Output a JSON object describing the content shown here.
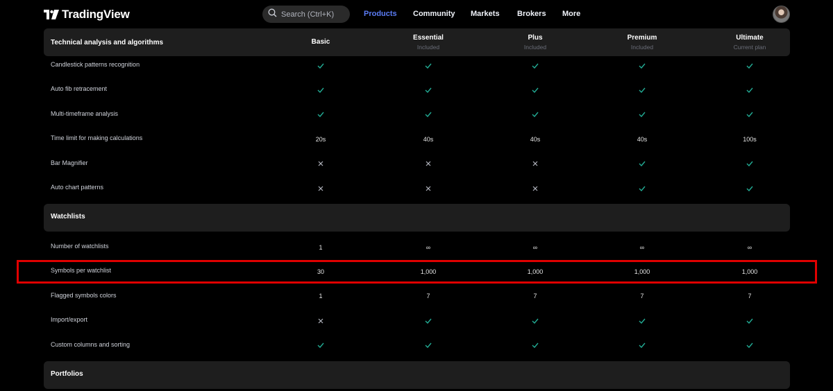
{
  "nav": {
    "brand": "TradingView",
    "search_placeholder": "Search (Ctrl+K)",
    "links": [
      "Products",
      "Community",
      "Markets",
      "Brokers",
      "More"
    ],
    "active_link": "Products"
  },
  "table": {
    "header_title": "Technical analysis and algorithms",
    "plans": [
      {
        "name": "Basic",
        "sub": ""
      },
      {
        "name": "Essential",
        "sub": "Included"
      },
      {
        "name": "Plus",
        "sub": "Included"
      },
      {
        "name": "Premium",
        "sub": "Included"
      },
      {
        "name": "Ultimate",
        "sub": "Current plan"
      }
    ],
    "technical_rows": [
      {
        "label": "Candlestick patterns recognition",
        "values": [
          "check",
          "check",
          "check",
          "check",
          "check"
        ]
      },
      {
        "label": "Auto fib retracement",
        "values": [
          "check",
          "check",
          "check",
          "check",
          "check"
        ]
      },
      {
        "label": "Multi-timeframe analysis",
        "values": [
          "check",
          "check",
          "check",
          "check",
          "check"
        ]
      },
      {
        "label": "Time limit for making calculations",
        "values": [
          "20s",
          "40s",
          "40s",
          "40s",
          "100s"
        ]
      },
      {
        "label": "Bar Magnifier",
        "values": [
          "cross",
          "cross",
          "cross",
          "check",
          "check"
        ]
      },
      {
        "label": "Auto chart patterns",
        "values": [
          "cross",
          "cross",
          "cross",
          "check",
          "check"
        ]
      }
    ],
    "watchlists_title": "Watchlists",
    "watchlist_rows": [
      {
        "label": "Number of watchlists",
        "values": [
          "1",
          "∞",
          "∞",
          "∞",
          "∞"
        ]
      },
      {
        "label": "Symbols per watchlist",
        "values": [
          "30",
          "1,000",
          "1,000",
          "1,000",
          "1,000"
        ],
        "highlighted": true
      },
      {
        "label": "Flagged symbols colors",
        "values": [
          "1",
          "7",
          "7",
          "7",
          "7"
        ]
      },
      {
        "label": "Import/export",
        "values": [
          "cross",
          "check",
          "check",
          "check",
          "check"
        ]
      },
      {
        "label": "Custom columns and sorting",
        "values": [
          "check",
          "check",
          "check",
          "check",
          "check"
        ]
      }
    ],
    "portfolios_title": "Portfolios"
  },
  "colors": {
    "check": "#22ab94",
    "cross": "#b2b5be",
    "highlight_border": "#e00000",
    "active_link": "#5b7cf5",
    "card_bg": "#1e1e1e"
  }
}
